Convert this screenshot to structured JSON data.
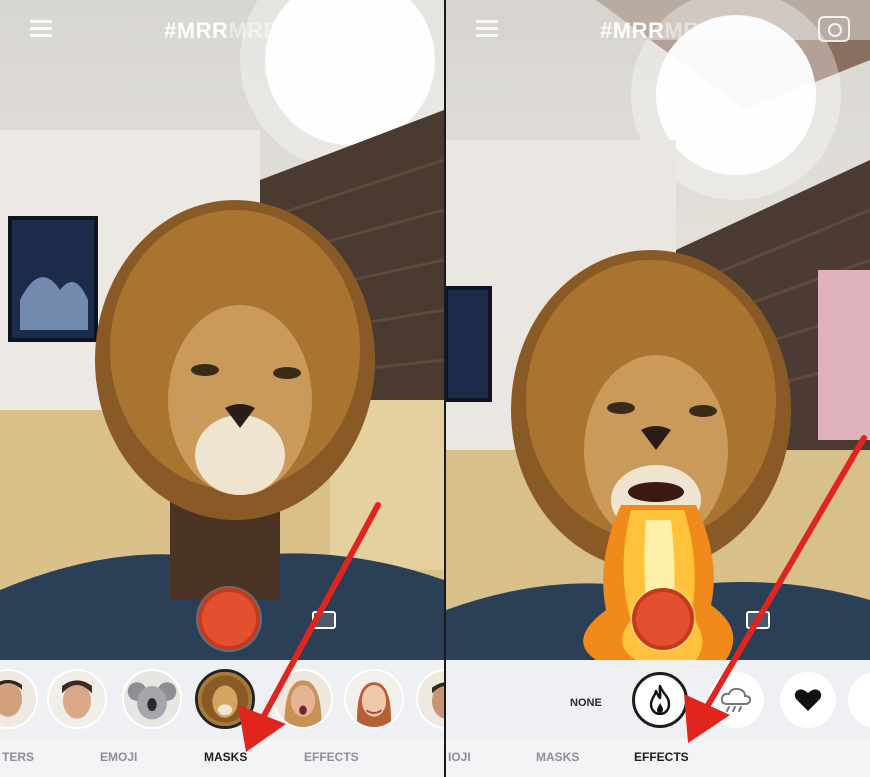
{
  "left": {
    "app_title_main": "#MRR",
    "app_title_dim": "MRR",
    "tabs": [
      {
        "label": "TERS"
      },
      {
        "label": "EMOJI"
      },
      {
        "label": "MASKS"
      },
      {
        "label": "EFFECTS"
      }
    ],
    "active_tab": "MASKS",
    "masks": [
      "avatar-man-1",
      "avatar-man-2",
      "koala-mask",
      "lion-mask",
      "avatar-woman-1",
      "avatar-woman-2"
    ]
  },
  "right": {
    "app_title_main": "#MRR",
    "app_title_dim": "MRR",
    "tabs": [
      {
        "label": "IOJI"
      },
      {
        "label": "MASKS"
      },
      {
        "label": "EFFECTS"
      }
    ],
    "active_tab": "EFFECTS",
    "effects": {
      "none_label": "NONE",
      "items": [
        "fire-icon",
        "rain-cloud-icon",
        "heart-icon"
      ]
    }
  },
  "colors": {
    "record": "#e4502f",
    "arrow": "#e0241e",
    "tab_active": "#1d1d1d",
    "tab_inactive": "#8e9096"
  }
}
